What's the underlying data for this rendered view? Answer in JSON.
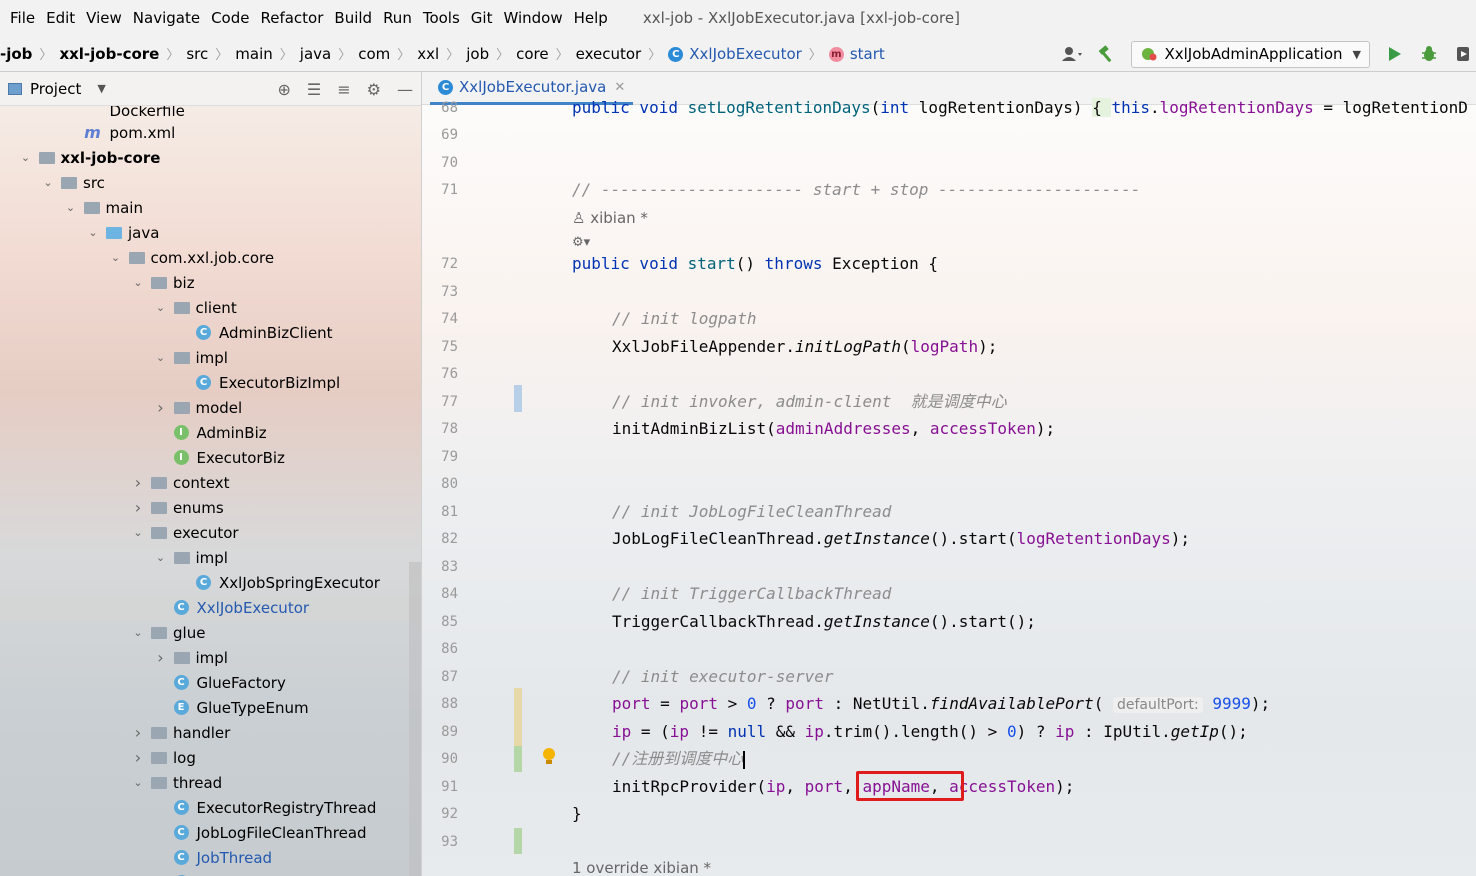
{
  "menu": {
    "items": [
      "File",
      "Edit",
      "View",
      "Navigate",
      "Code",
      "Refactor",
      "Build",
      "Run",
      "Tools",
      "Git",
      "Window",
      "Help"
    ],
    "window_title": "xxl-job - XxlJobExecutor.java [xxl-job-core]"
  },
  "breadcrumbs": {
    "items": [
      "-job",
      "xxl-job-core",
      "src",
      "main",
      "java",
      "com",
      "xxl",
      "job",
      "core",
      "executor"
    ],
    "class_name": "XxlJobExecutor",
    "method_name": "start"
  },
  "toolbar": {
    "run_config": "XxlJobAdminApplication"
  },
  "project_panel": {
    "title": "Project",
    "tree": [
      {
        "label": "Dockerfile",
        "indent": 3,
        "icon": "file",
        "arrow": "none",
        "cut": true
      },
      {
        "label": "pom.xml",
        "indent": 3,
        "icon": "maven",
        "arrow": "none"
      },
      {
        "label": "xxl-job-core",
        "indent": 1,
        "icon": "module",
        "arrow": "down",
        "bold": true
      },
      {
        "label": "src",
        "indent": 2,
        "icon": "folder",
        "arrow": "down"
      },
      {
        "label": "main",
        "indent": 3,
        "icon": "folder",
        "arrow": "down"
      },
      {
        "label": "java",
        "indent": 4,
        "icon": "java",
        "arrow": "down"
      },
      {
        "label": "com.xxl.job.core",
        "indent": 5,
        "icon": "package",
        "arrow": "down"
      },
      {
        "label": "biz",
        "indent": 6,
        "icon": "package",
        "arrow": "down"
      },
      {
        "label": "client",
        "indent": 7,
        "icon": "package",
        "arrow": "down"
      },
      {
        "label": "AdminBizClient",
        "indent": 8,
        "icon": "class",
        "arrow": "none"
      },
      {
        "label": "impl",
        "indent": 7,
        "icon": "package",
        "arrow": "down"
      },
      {
        "label": "ExecutorBizImpl",
        "indent": 8,
        "icon": "class",
        "arrow": "none"
      },
      {
        "label": "model",
        "indent": 7,
        "icon": "package",
        "arrow": "right"
      },
      {
        "label": "AdminBiz",
        "indent": 7,
        "icon": "interface",
        "arrow": "none"
      },
      {
        "label": "ExecutorBiz",
        "indent": 7,
        "icon": "interface",
        "arrow": "none"
      },
      {
        "label": "context",
        "indent": 6,
        "icon": "package",
        "arrow": "right"
      },
      {
        "label": "enums",
        "indent": 6,
        "icon": "package",
        "arrow": "right"
      },
      {
        "label": "executor",
        "indent": 6,
        "icon": "package",
        "arrow": "down"
      },
      {
        "label": "impl",
        "indent": 7,
        "icon": "package",
        "arrow": "down"
      },
      {
        "label": "XxlJobSpringExecutor",
        "indent": 8,
        "icon": "class",
        "arrow": "none"
      },
      {
        "label": "XxlJobExecutor",
        "indent": 7,
        "icon": "class",
        "arrow": "none",
        "selected": true,
        "blue": true
      },
      {
        "label": "glue",
        "indent": 6,
        "icon": "package",
        "arrow": "down"
      },
      {
        "label": "impl",
        "indent": 7,
        "icon": "package",
        "arrow": "right"
      },
      {
        "label": "GlueFactory",
        "indent": 7,
        "icon": "class",
        "arrow": "none"
      },
      {
        "label": "GlueTypeEnum",
        "indent": 7,
        "icon": "enum",
        "arrow": "none"
      },
      {
        "label": "handler",
        "indent": 6,
        "icon": "package",
        "arrow": "right"
      },
      {
        "label": "log",
        "indent": 6,
        "icon": "package",
        "arrow": "right"
      },
      {
        "label": "thread",
        "indent": 6,
        "icon": "package",
        "arrow": "down"
      },
      {
        "label": "ExecutorRegistryThread",
        "indent": 7,
        "icon": "class",
        "arrow": "none"
      },
      {
        "label": "JobLogFileCleanThread",
        "indent": 7,
        "icon": "class",
        "arrow": "none"
      },
      {
        "label": "JobThread",
        "indent": 7,
        "icon": "class",
        "arrow": "none",
        "blue": true
      },
      {
        "label": "TriggerCallbackThread",
        "indent": 7,
        "icon": "class",
        "arrow": "none"
      }
    ]
  },
  "editor": {
    "tab_label": "XxlJobExecutor.java",
    "line_numbers": [
      "68",
      "69",
      "70",
      "71",
      "72",
      "73",
      "74",
      "75",
      "76",
      "77",
      "78",
      "79",
      "80",
      "81",
      "82",
      "83",
      "84",
      "85",
      "86",
      "87",
      "88",
      "89",
      "90",
      "91",
      "92",
      "93"
    ],
    "author_hint_1": "xibian *",
    "author_hint_2": "1 override   xibian *",
    "param_hint": "defaultPort:",
    "lines": {
      "l68": "public void setLogRetentionDays(int logRetentionDays) { this.logRetentionDays = logRetentionD",
      "l71": "// --------------------- start + stop ---------------------",
      "l72a": "public void ",
      "l72b": "start",
      "l72c": "() ",
      "l72d": "throws",
      "l72e": " Exception {",
      "l74": "// init logpath",
      "l75a": "XxlJobFileAppender.",
      "l75b": "initLogPath",
      "l75c": "(",
      "l75d": "logPath",
      "l75e": ");",
      "l77": "// init invoker, admin-client  就是调度中心",
      "l78a": "initAdminBizList(",
      "l78b": "adminAddresses",
      "l78c": ", ",
      "l78d": "accessToken",
      "l78e": ");",
      "l81": "// init JobLogFileCleanThread",
      "l82a": "JobLogFileCleanThread.",
      "l82b": "getInstance",
      "l82c": "().start(",
      "l82d": "logRetentionDays",
      "l82e": ");",
      "l84": "// init TriggerCallbackThread",
      "l85a": "TriggerCallbackThread.",
      "l85b": "getInstance",
      "l85c": "().start();",
      "l87": "// init executor-server",
      "l88a": "port",
      "l88b": " = ",
      "l88c": "port",
      "l88d": " > ",
      "l88e": "0",
      "l88f": " ? ",
      "l88g": "port",
      "l88h": " : NetUtil.",
      "l88i": "findAvailablePort",
      "l88j": "( ",
      "l88k": "9999",
      "l88l": ");",
      "l89a": "ip",
      "l89b": " = (",
      "l89c": "ip",
      "l89d": " != ",
      "l89e": "null",
      "l89f": " && ",
      "l89g": "ip",
      "l89h": ".trim().length() > ",
      "l89i": "0",
      "l89j": ") ? ",
      "l89k": "ip",
      "l89l": " : IpUtil.",
      "l89m": "getIp",
      "l89n": "();",
      "l90": "//注册到调度中心",
      "l91a": "initRpcProvider(",
      "l91b": "ip",
      "l91c": ", ",
      "l91d": "port",
      "l91e": ", ",
      "l91f": "appName",
      "l91g": ", ",
      "l91h": "accessToken",
      "l91i": ");",
      "l92": "}"
    }
  }
}
